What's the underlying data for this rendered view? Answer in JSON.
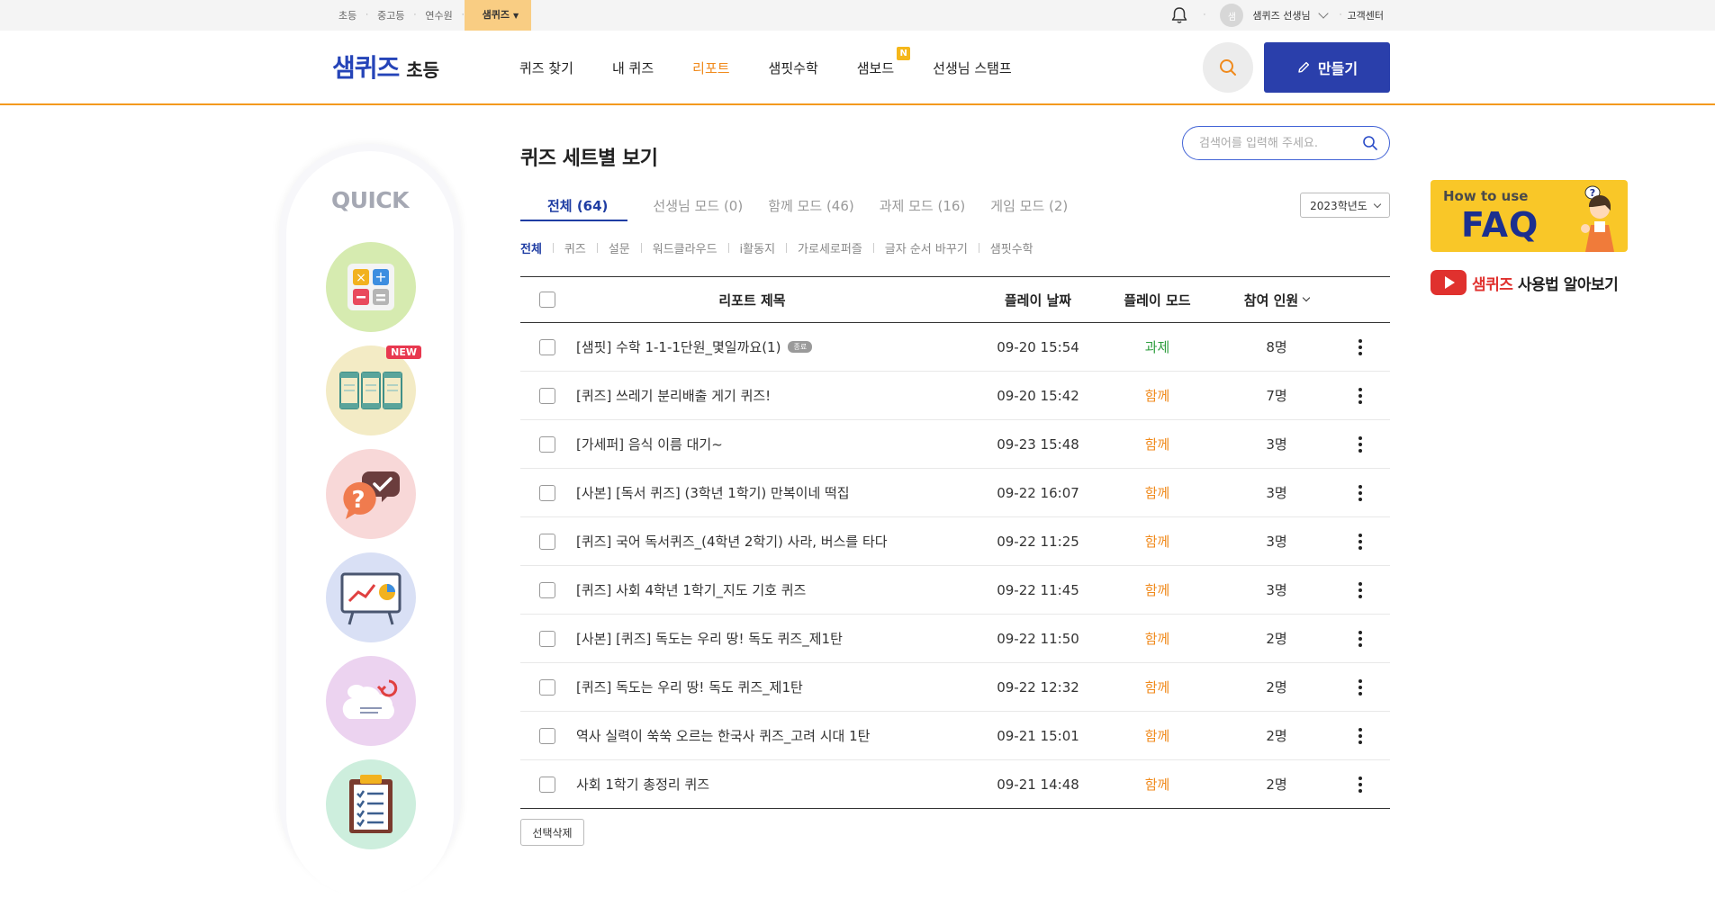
{
  "topbar": {
    "links": [
      {
        "label": "초등"
      },
      {
        "label": "중고등"
      },
      {
        "label": "연수원"
      },
      {
        "label": "샘퀴즈"
      }
    ],
    "avatar_text": "샘",
    "user_name": "샘퀴즈 선생님",
    "help_center": "고객센터"
  },
  "header": {
    "brand": "샘퀴즈",
    "brand_sub": "초등",
    "nav": [
      {
        "label": "퀴즈 찾기"
      },
      {
        "label": "내 퀴즈"
      },
      {
        "label": "리포트"
      },
      {
        "label": "샘핏수학"
      },
      {
        "label": "샘보드",
        "badge": "N"
      },
      {
        "label": "선생님 스탬프"
      }
    ],
    "make_label": "만들기"
  },
  "quick": {
    "title": "QUICK",
    "items": [
      {
        "icon": "calculator-icon",
        "bg": "#d6ebb0"
      },
      {
        "icon": "bookshelf-icon",
        "bg": "#f3ebc5",
        "badge": "NEW"
      },
      {
        "icon": "question-bubble-icon",
        "bg": "#f8d8d8"
      },
      {
        "icon": "presentation-chart-icon",
        "bg": "#d9e0f5"
      },
      {
        "icon": "cloud-sync-icon",
        "bg": "#ecd3f0"
      },
      {
        "icon": "clipboard-checklist-icon",
        "bg": "#cdeedd"
      }
    ]
  },
  "main": {
    "title": "퀴즈 세트별 보기",
    "search_placeholder": "검색어를 입력해 주세요.",
    "tabs": [
      {
        "label": "전체 (64)"
      },
      {
        "label": "선생님 모드 (0)"
      },
      {
        "label": "함께 모드 (46)"
      },
      {
        "label": "과제 모드 (16)"
      },
      {
        "label": "게임 모드 (2)"
      }
    ],
    "year_select": "2023학년도",
    "filters": [
      {
        "label": "전체"
      },
      {
        "label": "퀴즈"
      },
      {
        "label": "설문"
      },
      {
        "label": "워드클라우드"
      },
      {
        "label": "i활동지"
      },
      {
        "label": "가로세로퍼즐"
      },
      {
        "label": "글자 순서 바꾸기"
      },
      {
        "label": "샘핏수학"
      }
    ],
    "table": {
      "headers": {
        "title": "리포트 제목",
        "date": "플레이 날짜",
        "mode": "플레이 모드",
        "people": "참여 인원"
      },
      "rows": [
        {
          "title": "[샘핏] 수학 1-1-1단원_몇일까요(1)",
          "badge": "종료",
          "date": "09-20 15:54",
          "mode": "과제",
          "people": "8명"
        },
        {
          "title": "[퀴즈] 쓰레기 분리배출 게기 퀴즈!",
          "date": "09-20 15:42",
          "mode": "함께",
          "people": "7명"
        },
        {
          "title": "[가세퍼] 음식 이름 대기~",
          "date": "09-23 15:48",
          "mode": "함께",
          "people": "3명"
        },
        {
          "title": "[사본] [독서 퀴즈] (3학년 1학기) 만복이네 떡집",
          "date": "09-22 16:07",
          "mode": "함께",
          "people": "3명"
        },
        {
          "title": "[퀴즈] 국어 독서퀴즈_(4학년 2학기) 사라, 버스를 타다",
          "date": "09-22 11:25",
          "mode": "함께",
          "people": "3명"
        },
        {
          "title": "[퀴즈] 사회 4학년 1학기_지도 기호 퀴즈",
          "date": "09-22 11:45",
          "mode": "함께",
          "people": "3명"
        },
        {
          "title": "[사본] [퀴즈] 독도는 우리 땅! 독도 퀴즈_제1탄",
          "date": "09-22 11:50",
          "mode": "함께",
          "people": "2명"
        },
        {
          "title": "[퀴즈] 독도는 우리 땅! 독도 퀴즈_제1탄",
          "date": "09-22 12:32",
          "mode": "함께",
          "people": "2명"
        },
        {
          "title": "역사 실력이 쑥쑥 오르는 한국사 퀴즈_고려 시대 1탄",
          "date": "09-21 15:01",
          "mode": "함께",
          "people": "2명"
        },
        {
          "title": "사회 1학기 총정리 퀴즈",
          "date": "09-21 14:48",
          "mode": "함께",
          "people": "2명"
        }
      ]
    },
    "delete_label": "선택삭제"
  },
  "banners": {
    "faq_small": "How to use",
    "faq_big": "FAQ",
    "youtube_brand": "샘퀴즈",
    "youtube_text": " 사용법 알아보기"
  },
  "colors": {
    "accent": "#f08a1c",
    "primary": "#2a3fab",
    "task_mode": "#2e9e3e",
    "together_mode": "#f08a1c"
  }
}
